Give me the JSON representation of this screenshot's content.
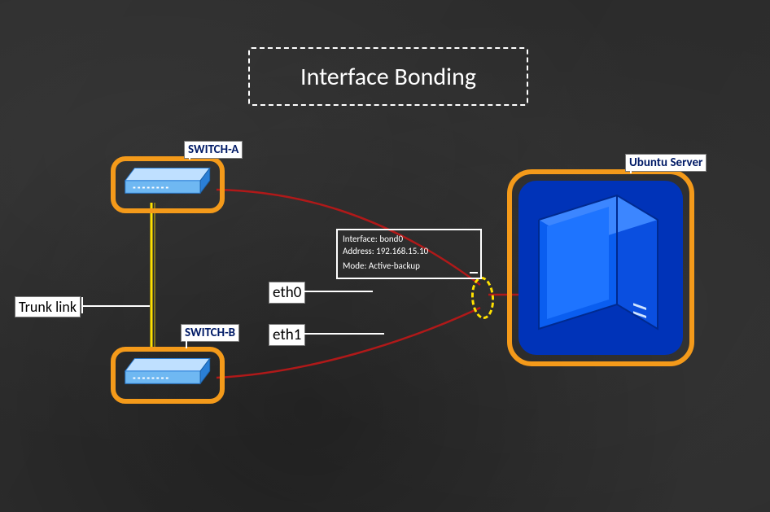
{
  "title": "Interface Bonding",
  "devices": {
    "switch_a": {
      "label": "SWITCH-A"
    },
    "switch_b": {
      "label": "SWITCH-B"
    },
    "server": {
      "label": "Ubuntu Server"
    }
  },
  "links": {
    "trunk": {
      "label": "Trunk link"
    },
    "eth0": {
      "label": "eth0"
    },
    "eth1": {
      "label": "eth1"
    }
  },
  "bond": {
    "interface_label": "Interface:",
    "interface_value": "bond0",
    "address_label": "Address:",
    "address_value": "192.168.15.10",
    "mode_label": "Mode:",
    "mode_value": "Active-backup"
  },
  "colors": {
    "accent_orange": "#f49a1a",
    "cable_red": "#b01919",
    "trunk_yellow": "#ffe100",
    "switch_light": "#bfe0ff",
    "switch_mid": "#6fb8f2",
    "switch_dark": "#2b7fd6",
    "server_blue": "#0a5ef0",
    "server_dark": "#0033b8",
    "server_light": "#3c86ff",
    "navy_text": "#001a66"
  }
}
